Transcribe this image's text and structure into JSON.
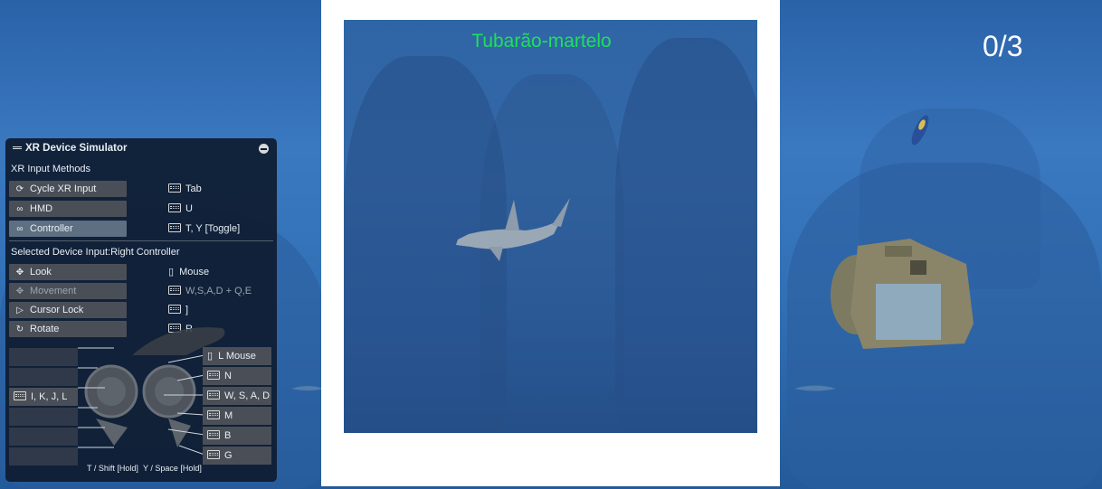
{
  "hud": {
    "species_label": "Tubarão-martelo",
    "counter": "0/3"
  },
  "xr_simulator": {
    "title": "XR Device Simulator",
    "input_methods_heading": "XR Input Methods",
    "input_methods": [
      {
        "label": "Cycle XR Input",
        "key": "Tab",
        "icon": "cycle-icon"
      },
      {
        "label": "HMD",
        "key": "U",
        "icon": "vr-headset-icon"
      },
      {
        "label": "Controller",
        "key": "T, Y [Toggle]",
        "icon": "vr-headset-icon"
      }
    ],
    "selected_device_heading": "Selected Device Input:Right Controller",
    "device_inputs": [
      {
        "label": "Look",
        "key": "Mouse",
        "icon": "move-arrows-icon",
        "key_icon": "mouse-icon"
      },
      {
        "label": "Movement",
        "key": "W,S,A,D + Q,E",
        "icon": "move-arrows-icon",
        "key_icon": "keyboard-icon"
      },
      {
        "label": "Cursor Lock",
        "key": "]",
        "icon": "cursor-icon",
        "key_icon": "keyboard-icon"
      },
      {
        "label": "Rotate",
        "key": "R",
        "icon": "rotate-icon",
        "key_icon": "keyboard-icon"
      }
    ],
    "left_controller_keys": [
      "",
      "",
      "I, K, J, L",
      "",
      "",
      ""
    ],
    "right_controller_keys": [
      {
        "key": "L Mouse",
        "icon": "mouse-icon"
      },
      {
        "key": "N",
        "icon": "keyboard-icon"
      },
      {
        "key": "W, S, A, D",
        "icon": "keyboard-icon"
      },
      {
        "key": "M",
        "icon": "keyboard-icon"
      },
      {
        "key": "B",
        "icon": "keyboard-icon"
      },
      {
        "key": "G",
        "icon": "keyboard-icon"
      }
    ],
    "footer_left": "T / Shift [Hold]",
    "footer_right": "Y / Space [Hold]"
  },
  "colors": {
    "species_label": "#1ee05a",
    "water": "#3a78c0",
    "panel_bg": "#0e1c30",
    "button_bg": "#4a4f57"
  }
}
